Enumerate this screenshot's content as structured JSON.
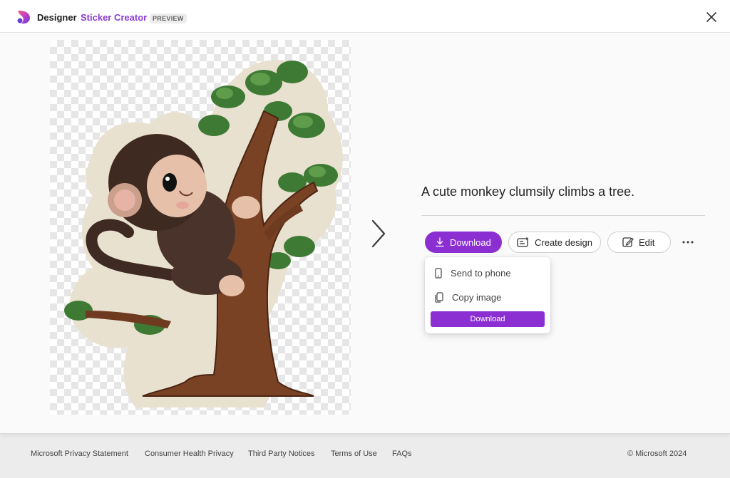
{
  "header": {
    "brand": "Designer",
    "product": "Sticker Creator",
    "badge": "PREVIEW"
  },
  "sticker": {
    "subject": "monkey-climbing-tree-sticker"
  },
  "panel": {
    "prompt": "A cute monkey clumsily climbs a tree.",
    "buttons": {
      "download": "Download",
      "create_design": "Create design",
      "edit": "Edit"
    }
  },
  "menu": {
    "send_to_phone": "Send to phone",
    "copy_image": "Copy image",
    "download": "Download"
  },
  "footer": {
    "links": [
      "Microsoft Privacy Statement",
      "Consumer Health Privacy",
      "Third Party Notices",
      "Terms of Use",
      "FAQs"
    ],
    "copyright": "© Microsoft 2024"
  },
  "colors": {
    "accent": "#8b2fd3",
    "brand_text": "#8a3ccf"
  },
  "icons": [
    "designer-logo-icon",
    "close-icon",
    "chevron-right-icon",
    "download-icon",
    "create-design-icon",
    "edit-icon",
    "more-icon",
    "phone-icon",
    "copy-icon"
  ]
}
